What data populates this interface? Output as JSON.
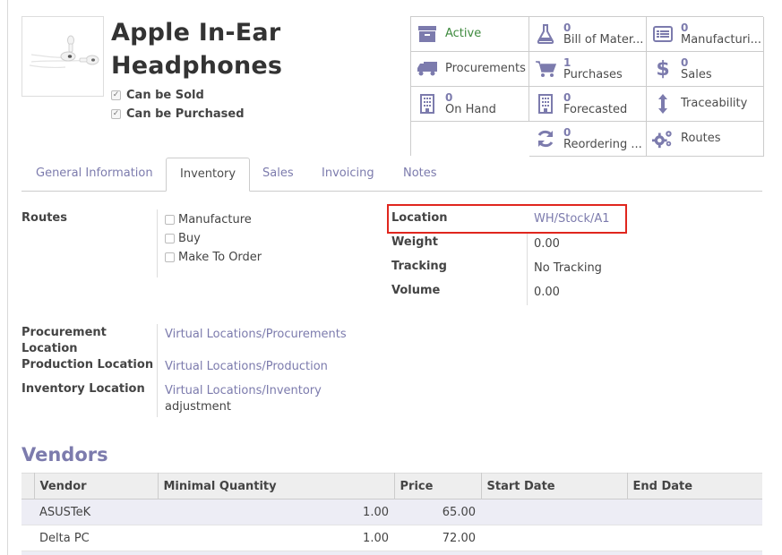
{
  "product": {
    "name": "Apple In-Ear Headphones",
    "can_be_sold": "Can be Sold",
    "can_be_purchased": "Can be Purchased"
  },
  "smart_buttons": [
    {
      "id": "active",
      "icon": "archive-icon",
      "number": "",
      "label": "Active"
    },
    {
      "id": "bom",
      "icon": "flask-icon",
      "number": "0",
      "label": "Bill of Mater..."
    },
    {
      "id": "manufacturing",
      "icon": "list-icon",
      "number": "0",
      "label": "Manufacturi..."
    },
    {
      "id": "procurements",
      "icon": "truck-icon",
      "number": "",
      "label": "Procurements"
    },
    {
      "id": "purchases",
      "icon": "cart-icon",
      "number": "1",
      "label": "Purchases"
    },
    {
      "id": "sales",
      "icon": "dollar-icon",
      "number": "0",
      "label": "Sales"
    },
    {
      "id": "on_hand",
      "icon": "building-icon",
      "number": "0",
      "label": "On Hand"
    },
    {
      "id": "forecasted",
      "icon": "building-icon",
      "number": "0",
      "label": "Forecasted"
    },
    {
      "id": "traceability",
      "icon": "arrows-v-icon",
      "number": "",
      "label": "Traceability"
    },
    {
      "id": "reordering",
      "icon": "refresh-icon",
      "number": "0",
      "label": "Reordering ..."
    },
    {
      "id": "routes",
      "icon": "cogs-icon",
      "number": "",
      "label": "Routes"
    }
  ],
  "tabs": [
    "General Information",
    "Inventory",
    "Sales",
    "Invoicing",
    "Notes"
  ],
  "active_tab": "Inventory",
  "inventory": {
    "routes_label": "Routes",
    "routes": [
      "Manufacture",
      "Buy",
      "Make To Order"
    ],
    "location_label": "Location",
    "location_value": "WH/Stock/A1",
    "weight_label": "Weight",
    "weight_value": "0.00",
    "tracking_label": "Tracking",
    "tracking_value": "No Tracking",
    "volume_label": "Volume",
    "volume_value": "0.00",
    "procurement_location_label": "Procurement Location",
    "procurement_location_value": "Virtual Locations/Procurements",
    "production_location_label": "Production Location",
    "production_location_value": "Virtual Locations/Production",
    "inventory_location_label": "Inventory Location",
    "inventory_location_value_link": "Virtual Locations/Inventory",
    "inventory_location_value_rest": "adjustment"
  },
  "vendors": {
    "title": "Vendors",
    "columns": [
      "Vendor",
      "Minimal Quantity",
      "Price",
      "Start Date",
      "End Date"
    ],
    "rows": [
      {
        "vendor": "ASUSTeK",
        "min_qty": "1.00",
        "price": "65.00",
        "start": "",
        "end": ""
      },
      {
        "vendor": "Delta PC",
        "min_qty": "1.00",
        "price": "72.00",
        "start": "",
        "end": ""
      }
    ]
  },
  "colors": {
    "accent": "#7c7bad",
    "active_green": "#3e8a3e",
    "highlight": "#e0261e"
  }
}
